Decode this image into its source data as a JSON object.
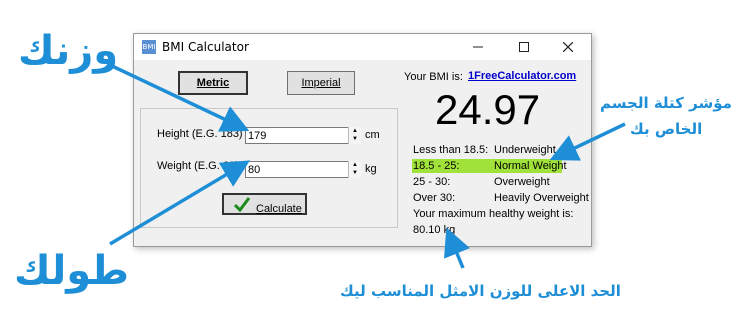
{
  "annotations": {
    "weight": "وزنك",
    "height": "طولك",
    "bmi_line1": "مؤشر كتلة الجسم",
    "bmi_line2": "الخاص بك",
    "max_weight": "الحد الاعلى للوزن الامثل المناسب ليك"
  },
  "annotation_color": "#1e8fd6",
  "window": {
    "title": "BMI Calculator",
    "app_icon_text": "BMI",
    "controls": [
      "minimize-icon",
      "maximize-icon",
      "close-icon"
    ]
  },
  "units": {
    "metric_label": "Metric",
    "imperial_label": "Imperial"
  },
  "inputs": {
    "height_label": "Height (E.G. 183)",
    "height_value": "179",
    "height_unit": "cm",
    "weight_label": "Weight (E.G. 63)",
    "weight_value": "80",
    "weight_unit": "kg"
  },
  "calculate_label": "Calculate",
  "result": {
    "your_bmi_label": "Your BMI is:",
    "site": "1FreeCalculator.com",
    "bmi": "24.97",
    "categories": [
      {
        "range": "Less than 18.5:",
        "label": "Underweight"
      },
      {
        "range": "18.5 - 25:",
        "label": "Normal Weight"
      },
      {
        "range": "25 - 30:",
        "label": "Overweight"
      },
      {
        "range": "Over 30:",
        "label": "Heavily Overweight"
      }
    ],
    "highlight_color": "#a0e23a",
    "max_label": "Your maximum healthy weight is:",
    "max_value": "80.10 kg"
  }
}
